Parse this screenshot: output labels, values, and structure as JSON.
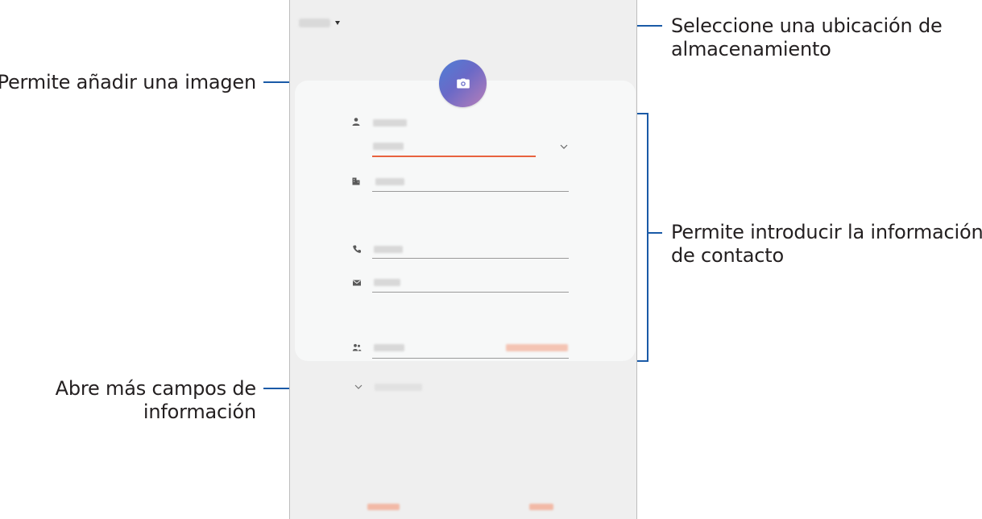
{
  "annotations": {
    "storage_line1": "Seleccione una ubicación de",
    "storage_line2": "almacenamiento",
    "image": "Permite añadir una imagen",
    "info_line1": "Permite introducir la información",
    "info_line2": "de contacto",
    "more_line1": "Abre más campos de",
    "more_line2": "información"
  },
  "colors": {
    "leader": "#1a5aa7",
    "active_underline": "#e8633f",
    "avatar_gradient": [
      "#4e7fd6",
      "#6a69c7",
      "#b87fb9"
    ]
  },
  "icons": {
    "storage": "dropdown-caret-icon",
    "avatar": "camera-icon",
    "name": "person-icon",
    "company": "building-icon",
    "phone": "phone-icon",
    "email": "envelope-icon",
    "groups": "group-icon",
    "expand": "chevron-down-icon",
    "more": "chevron-down-icon"
  }
}
